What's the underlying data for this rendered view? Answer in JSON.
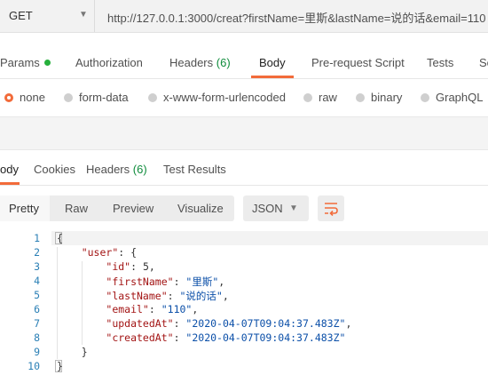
{
  "request": {
    "method": "GET",
    "url": "http://127.0.0.1:3000/creat?firstName=里斯&lastName=说的话&email=110"
  },
  "request_tabs": {
    "params": "Params",
    "authorization": "Authorization",
    "headers": "Headers",
    "headers_count": "(6)",
    "body": "Body",
    "pre_request": "Pre-request Script",
    "tests": "Tests",
    "settings": "Se"
  },
  "body_types": {
    "selected": "none",
    "options": [
      "none",
      "form-data",
      "x-www-form-urlencoded",
      "raw",
      "binary",
      "GraphQL"
    ]
  },
  "response_tabs": {
    "body": "ody",
    "cookies": "Cookies",
    "headers": "Headers",
    "headers_count": "(6)",
    "test_results": "Test Results"
  },
  "view_modes": {
    "pretty": "Pretty",
    "raw": "Raw",
    "preview": "Preview",
    "visualize": "Visualize",
    "format": "JSON"
  },
  "colors": {
    "accent": "#f26b3a",
    "json_key": "#a31515",
    "json_string": "#0b4fa8",
    "line_number": "#2a7fb5",
    "count_green": "#0f8c3c"
  },
  "response_body": {
    "line_numbers": [
      "1",
      "2",
      "3",
      "4",
      "5",
      "6",
      "7",
      "8",
      "9",
      "10"
    ],
    "lines": [
      {
        "indent": "",
        "key": "",
        "value": "",
        "text": "{"
      },
      {
        "indent": "    ",
        "key": "\"user\"",
        "value": "",
        "text": ": {"
      },
      {
        "indent": "        ",
        "key": "\"id\"",
        "value": "",
        "text": ": 5,"
      },
      {
        "indent": "        ",
        "key": "\"firstName\"",
        "value": "\"里斯\"",
        "text": ","
      },
      {
        "indent": "        ",
        "key": "\"lastName\"",
        "value": "\"说的话\"",
        "text": ","
      },
      {
        "indent": "        ",
        "key": "\"email\"",
        "value": "\"110\"",
        "text": ","
      },
      {
        "indent": "        ",
        "key": "\"updatedAt\"",
        "value": "\"2020-04-07T09:04:37.483Z\"",
        "text": ","
      },
      {
        "indent": "        ",
        "key": "\"createdAt\"",
        "value": "\"2020-04-07T09:04:37.483Z\"",
        "text": ""
      },
      {
        "indent": "    ",
        "key": "",
        "value": "",
        "text": "}"
      },
      {
        "indent": "",
        "key": "",
        "value": "",
        "text": "}"
      }
    ]
  }
}
